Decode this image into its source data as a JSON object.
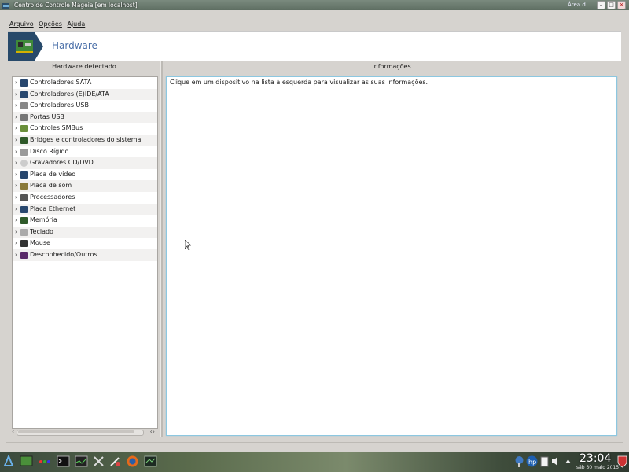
{
  "window": {
    "title": "Centro de Controle Mageia  [em localhost]",
    "right_text": "Área d"
  },
  "menu": [
    "Arquivo",
    "Opções",
    "Ajuda"
  ],
  "header": {
    "title": "Hardware"
  },
  "left_panel": {
    "title": "Hardware detectado",
    "items": [
      {
        "label": "Controladores SATA",
        "icon": "sata-controller-icon"
      },
      {
        "label": "Controladores (E)IDE/ATA",
        "icon": "ide-controller-icon"
      },
      {
        "label": "Controladores USB",
        "icon": "usb-controller-icon"
      },
      {
        "label": "Portas USB",
        "icon": "usb-port-icon"
      },
      {
        "label": "Controles SMBus",
        "icon": "smbus-icon"
      },
      {
        "label": "Bridges e controladores do sistema",
        "icon": "bridge-icon"
      },
      {
        "label": "Disco Rígido",
        "icon": "hard-disk-icon"
      },
      {
        "label": "Gravadores CD/DVD",
        "icon": "cd-dvd-icon"
      },
      {
        "label": "Placa de vídeo",
        "icon": "video-card-icon"
      },
      {
        "label": "Placa de som",
        "icon": "sound-card-icon"
      },
      {
        "label": "Processadores",
        "icon": "processor-icon"
      },
      {
        "label": "Placa Ethernet",
        "icon": "ethernet-icon"
      },
      {
        "label": "Memória",
        "icon": "memory-icon"
      },
      {
        "label": "Teclado",
        "icon": "keyboard-icon"
      },
      {
        "label": "Mouse",
        "icon": "mouse-icon"
      },
      {
        "label": "Desconhecido/Outros",
        "icon": "unknown-device-icon"
      }
    ]
  },
  "right_panel": {
    "title": "Informações",
    "message": "Clique em um dispositivo na lista à esquerda para visualizar as suas informações."
  },
  "taskbar": {
    "time": "23:04",
    "date": "sáb 30 maio 2015"
  }
}
